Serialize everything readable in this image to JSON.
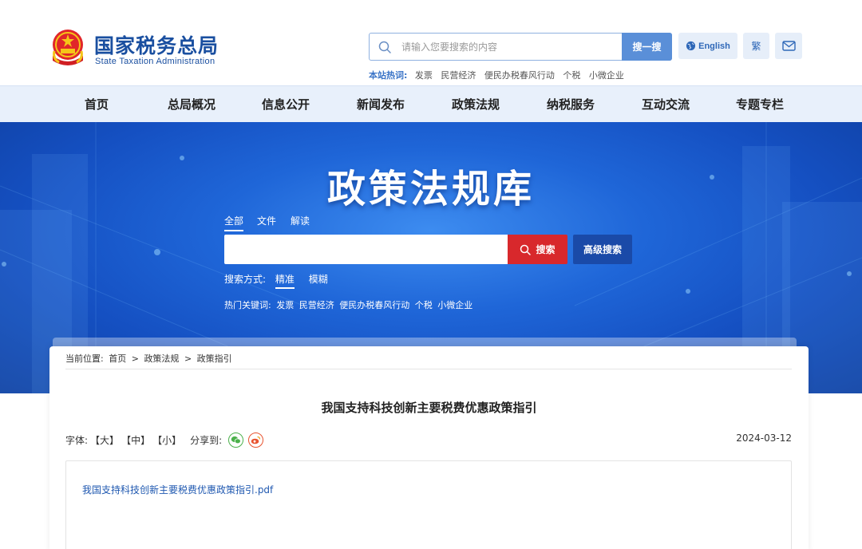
{
  "header": {
    "logo_cn": "国家税务总局",
    "logo_en": "State Taxation Administration",
    "search_placeholder": "请输入您要搜索的内容",
    "search_button": "搜一搜",
    "hot_label": "本站热词:",
    "hot_words": [
      "发票",
      "民营经济",
      "便民办税春风行动",
      "个税",
      "小微企业"
    ],
    "english_button": "English",
    "traditional_button": "繁",
    "mail_icon": "mail-icon"
  },
  "nav": {
    "items": [
      "首页",
      "总局概况",
      "信息公开",
      "新闻发布",
      "政策法规",
      "纳税服务",
      "互动交流",
      "专题专栏"
    ]
  },
  "banner": {
    "title": "政策法规库",
    "tabs": [
      "全部",
      "文件",
      "解读"
    ],
    "active_tab": "全部",
    "search_button": "搜索",
    "advanced_button": "高级搜索",
    "mode_label": "搜索方式:",
    "modes": [
      "精准",
      "模糊"
    ],
    "active_mode": "精准",
    "hot_label": "热门关键词:",
    "hot_words": [
      "发票",
      "民营经济",
      "便民办税春风行动",
      "个税",
      "小微企业"
    ]
  },
  "breadcrumb": {
    "label": "当前位置:",
    "items": [
      "首页",
      ">",
      "政策法规",
      ">",
      "政策指引"
    ]
  },
  "article": {
    "title": "我国支持科技创新主要税费优惠政策指引",
    "font_label": "字体:",
    "font_large": "【大】",
    "font_medium": "【中】",
    "font_small": "【小】",
    "share_label": "分享到:",
    "date": "2024-03-12",
    "attachment": "我国支持科技创新主要税费优惠政策指引.pdf"
  },
  "colors": {
    "brand_blue": "#1a4fa0",
    "search_button": "#5a8fd8",
    "banner_search_red": "#d8282c",
    "advanced_blue": "#1a4aa8",
    "link": "#1f58b0"
  }
}
